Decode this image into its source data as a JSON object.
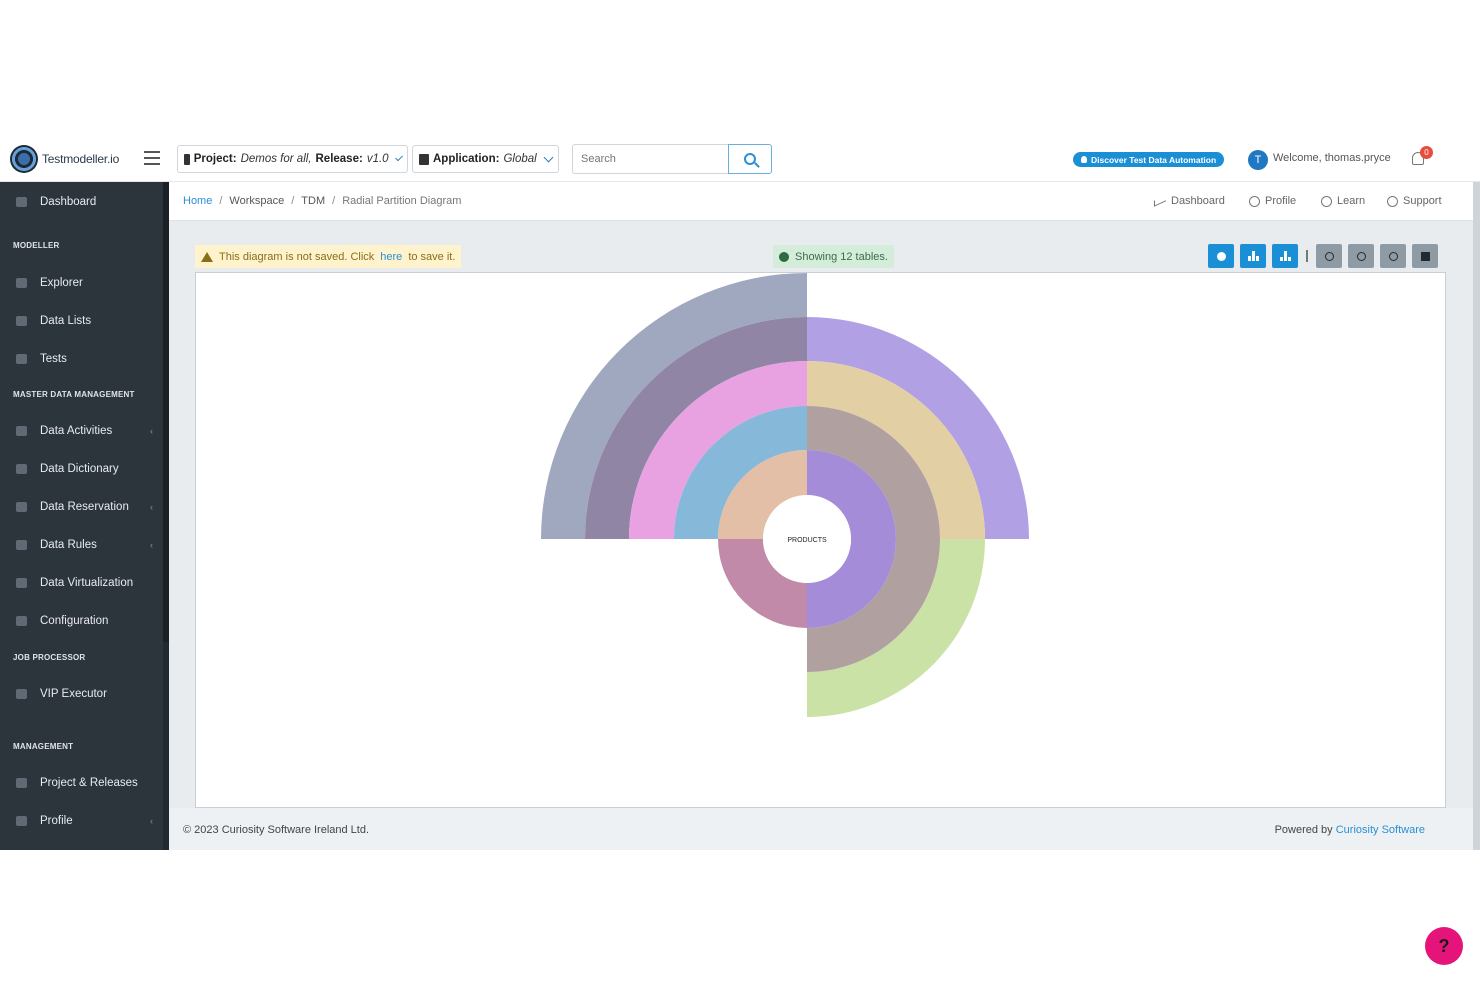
{
  "header": {
    "brand": "Testmodeller.io",
    "project_label": "Project:",
    "project_value": "Demos for all,",
    "release_label": "Release:",
    "release_value": "v1.0",
    "application_label": "Application:",
    "application_value": "Global",
    "search_placeholder": "Search",
    "discover_label": "Discover Test Data Automation",
    "user_initial": "T",
    "welcome": "Welcome, thomas.pryce",
    "notification_count": "0"
  },
  "sidebar": {
    "items": [
      {
        "label": "Dashboard"
      },
      {
        "section": "MODELLER"
      },
      {
        "label": "Explorer"
      },
      {
        "label": "Data Lists"
      },
      {
        "label": "Tests"
      },
      {
        "section": "MASTER DATA MANAGEMENT"
      },
      {
        "label": "Data Activities",
        "arrow": "‹"
      },
      {
        "label": "Data Dictionary"
      },
      {
        "label": "Data Reservation",
        "arrow": "‹"
      },
      {
        "label": "Data Rules",
        "arrow": "‹"
      },
      {
        "label": "Data Virtualization"
      },
      {
        "label": "Configuration"
      },
      {
        "section": "JOB PROCESSOR"
      },
      {
        "label": "VIP Executor"
      },
      {
        "section": "MANAGEMENT"
      },
      {
        "label": "Project & Releases"
      },
      {
        "label": "Profile",
        "arrow": "‹"
      }
    ]
  },
  "breadcrumb": [
    "Home",
    "Workspace",
    "TDM",
    "Radial Partition Diagram"
  ],
  "quick_links": [
    "Dashboard",
    "Profile",
    "Learn",
    "Support"
  ],
  "alerts": {
    "warning_prefix": "This diagram is not saved. Click",
    "warning_link": "here",
    "warning_suffix": "to save it.",
    "info": "Showing 12 tables."
  },
  "toolbar": {
    "buttons": [
      "settings-icon",
      "hierarchy-icon",
      "download-icon",
      "zoom-fit-icon",
      "zoom-in-icon",
      "zoom-out-icon",
      "stop-icon"
    ]
  },
  "diagram": {
    "center_label": "PRODUCTS",
    "colors": {
      "ring1_left": "#e2bfa6",
      "ring1_right": "#a48cd8",
      "ring1_bottom": "#c08aa8",
      "ring2_left": "#86b8da",
      "ring2_right": "#b0a1a0",
      "ring3_left": "#e8a2e2",
      "ring3_right": "#e2cfa4",
      "ring4_left": "#9185a6",
      "ring4_right": "#b1a1e4",
      "ring4_bottom": "#cbe2a6",
      "ring5_left": "#a0a8c0"
    }
  },
  "footer": {
    "copyright": "© 2023 Curiosity Software Ireland Ltd.",
    "powered_prefix": "Powered by",
    "powered_link": "Curiosity Software"
  }
}
